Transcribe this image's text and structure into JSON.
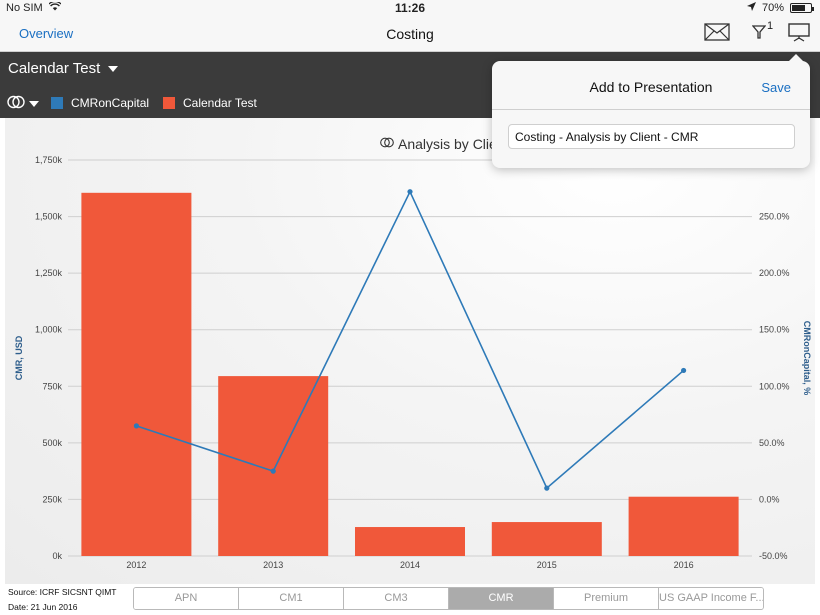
{
  "status": {
    "carrier": "No SIM",
    "time": "11:26",
    "battery": "70%",
    "battery_level": 0.7
  },
  "nav": {
    "back_label": "Overview",
    "title": "Costing",
    "filter_count": "1"
  },
  "report_selector": {
    "label": "Calendar Test"
  },
  "legend": {
    "items": [
      {
        "label": "CMRonCapital",
        "color": "#2e7ab8"
      },
      {
        "label": "Calendar Test",
        "color": "#f0583a"
      }
    ]
  },
  "chart_title": "Analysis by Clie",
  "popover": {
    "title": "Add to Presentation",
    "save_label": "Save",
    "input_value": "Costing - Analysis by Client - CMR"
  },
  "footer": {
    "source": "Source: ICRF SICSNT QIMT",
    "date": "Date: 21 Jun 2016"
  },
  "tabs": [
    {
      "label": "APN",
      "active": false
    },
    {
      "label": "CM1",
      "active": false
    },
    {
      "label": "CM3",
      "active": false
    },
    {
      "label": "CMR",
      "active": true
    },
    {
      "label": "Premium",
      "active": false
    },
    {
      "label": "US GAAP Income F...",
      "active": false
    }
  ],
  "chart_data": {
    "type": "bar",
    "categories": [
      "2012",
      "2013",
      "2014",
      "2015",
      "2016"
    ],
    "series": [
      {
        "name": "Calendar Test",
        "type": "bar",
        "axis": "left",
        "color": "#f0583a",
        "values": [
          1605,
          795,
          128,
          150,
          262
        ]
      },
      {
        "name": "CMRonCapital",
        "type": "line",
        "axis": "right",
        "color": "#2e7ab8",
        "values": [
          65,
          25,
          272,
          10,
          114
        ]
      }
    ],
    "ylabel": "CMR, USD",
    "y2label": "CMRonCapital, %",
    "ylim": [
      0,
      1750
    ],
    "y2lim": [
      -50,
      300
    ],
    "yticks": [
      "0k",
      "250k",
      "500k",
      "750k",
      "1,000k",
      "1,250k",
      "1,500k",
      "1,750k"
    ],
    "y2ticks": [
      "-50.0%",
      "0.0%",
      "50.0%",
      "100.0%",
      "150.0%",
      "200.0%",
      "250.0%"
    ],
    "grid": true
  }
}
